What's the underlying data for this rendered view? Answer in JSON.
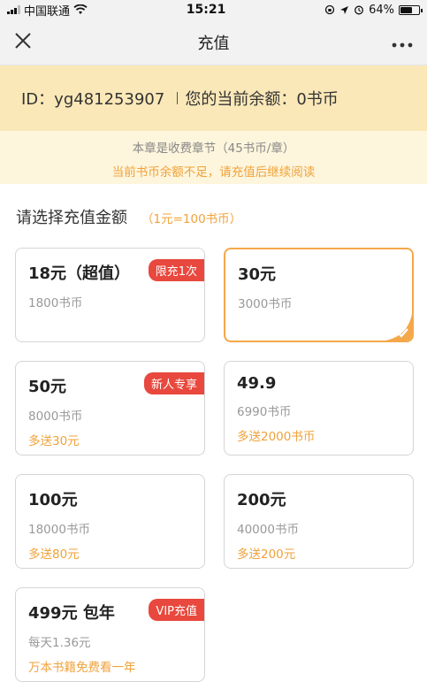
{
  "status_bar": {
    "carrier": "中国联通",
    "time": "15:21",
    "battery": "64%",
    "battery_level": 0.64
  },
  "nav": {
    "title": "充值"
  },
  "account": {
    "id_label": "ID：yg481253907",
    "balance_label": "您的当前余额：0书币"
  },
  "notice": {
    "line1": "本章是收费章节（45书币/章）",
    "line2": "当前书币余额不足，请充值后继续阅读"
  },
  "section": {
    "title": "请选择充值金额",
    "rate": "（1元=100书币）"
  },
  "packages": [
    {
      "price": "18元（超值）",
      "coins": "1800书币",
      "bonus": "",
      "tag": "限充1次",
      "selected": false
    },
    {
      "price": "30元",
      "coins": "3000书币",
      "bonus": "",
      "tag": "",
      "selected": true
    },
    {
      "price": "50元",
      "coins": "8000书币",
      "bonus": "多送30元",
      "tag": "新人专享",
      "selected": false
    },
    {
      "price": "49.9",
      "coins": "6990书币",
      "bonus": "多送2000书币",
      "tag": "",
      "selected": false
    },
    {
      "price": "100元",
      "coins": "18000书币",
      "bonus": "多送80元",
      "tag": "",
      "selected": false
    },
    {
      "price": "200元",
      "coins": "40000书币",
      "bonus": "多送200元",
      "tag": "",
      "selected": false
    },
    {
      "price": "499元 包年",
      "coins": "每天1.36元",
      "bonus": "万本书籍免费看一年",
      "tag": "VIP充值",
      "selected": false
    }
  ],
  "colors": {
    "accent": "#f0a23a",
    "tag_red": "#e8483d",
    "account_bg": "#fae8b8",
    "notice_bg": "#fdf5dc"
  }
}
